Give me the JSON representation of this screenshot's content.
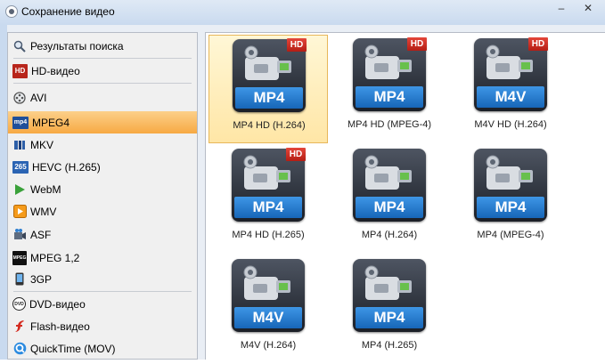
{
  "window": {
    "title": "Сохранение видео",
    "minimize": "–",
    "close": "✕"
  },
  "sidebar": {
    "items": [
      {
        "label": "Результаты поиска",
        "icon": "magnifier-icon"
      },
      {
        "label": "HD-видео",
        "icon": "hd-icon",
        "icon_text": "HD"
      },
      {
        "label": "AVI",
        "icon": "film-reel-icon"
      },
      {
        "label": "MPEG4",
        "icon": "mp4-icon",
        "icon_text": "mp4",
        "selected": true
      },
      {
        "label": "MKV",
        "icon": "mkv-icon"
      },
      {
        "label": "HEVC (H.265)",
        "icon": "hevc-icon",
        "icon_text": "265"
      },
      {
        "label": "WebM",
        "icon": "webm-play-icon"
      },
      {
        "label": "WMV",
        "icon": "wmv-icon"
      },
      {
        "label": "ASF",
        "icon": "asf-icon"
      },
      {
        "label": "MPEG 1,2",
        "icon": "mpeg-icon",
        "icon_text": "MPEG"
      },
      {
        "label": "3GP",
        "icon": "phone-icon"
      },
      {
        "label": "DVD-видео",
        "icon": "dvd-icon",
        "icon_text": "DVD"
      },
      {
        "label": "Flash-видео",
        "icon": "flash-icon"
      },
      {
        "label": "QuickTime (MOV)",
        "icon": "quicktime-icon"
      }
    ]
  },
  "formats": [
    {
      "badge": "MP4",
      "hd": "HD",
      "label": "MP4 HD (H.264)",
      "selected": true
    },
    {
      "badge": "MP4",
      "hd": "HD",
      "label": "MP4 HD (MPEG-4)"
    },
    {
      "badge": "M4V",
      "hd": "HD",
      "label": "M4V HD (H.264)"
    },
    {
      "badge": "MP4",
      "hd": "HD",
      "label": "MP4 HD (H.265)"
    },
    {
      "badge": "MP4",
      "label": "MP4 (H.264)"
    },
    {
      "badge": "MP4",
      "label": "MP4 (MPEG-4)"
    },
    {
      "badge": "M4V",
      "label": "M4V (H.264)"
    },
    {
      "badge": "MP4",
      "label": "MP4 (H.265)"
    }
  ],
  "colors": {
    "selection": "#f7a943",
    "badge_blue": "#1766b8",
    "hd_red": "#c8281e"
  }
}
